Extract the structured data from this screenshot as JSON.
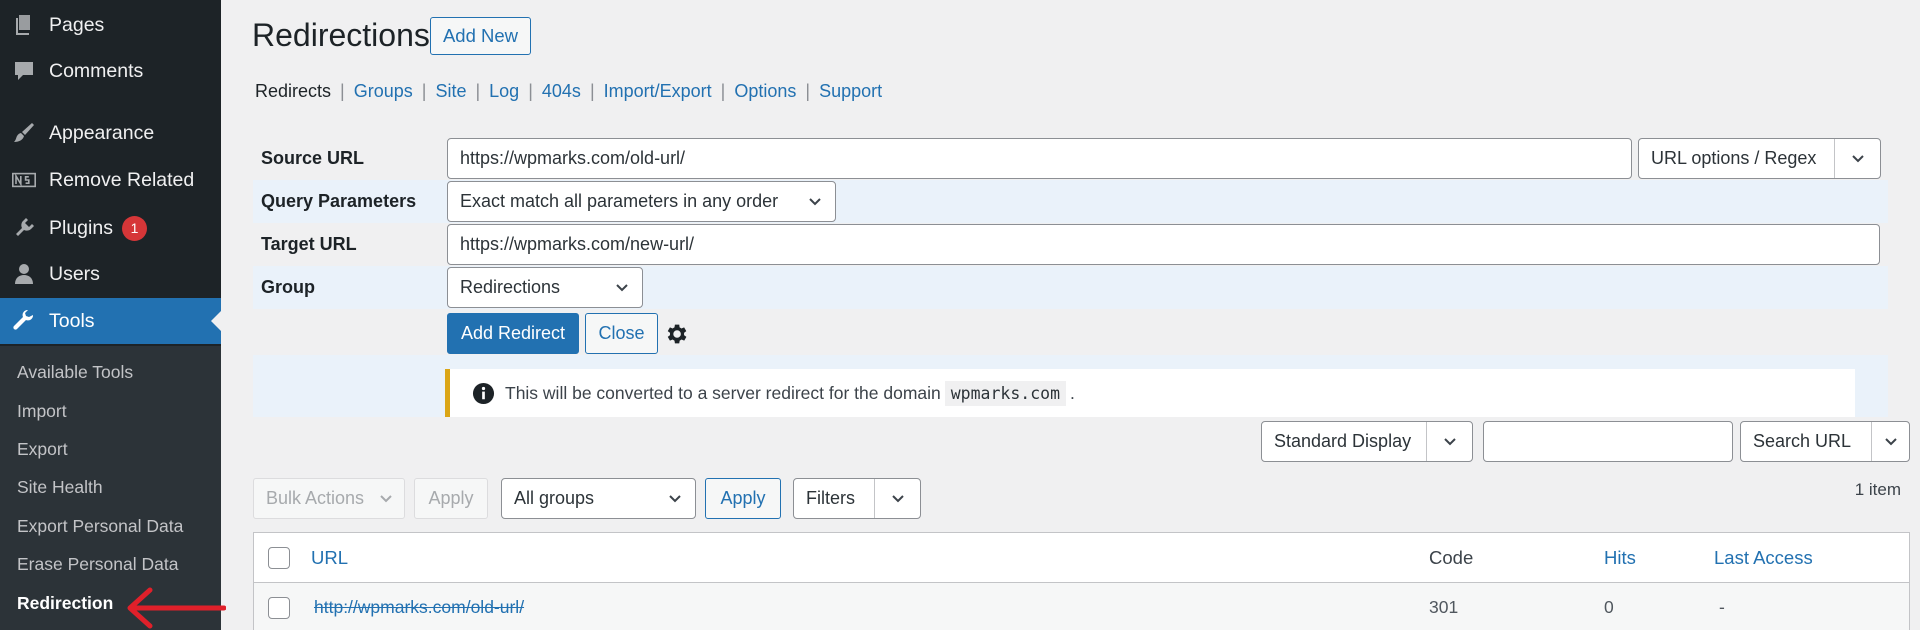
{
  "sidebar": {
    "items": [
      {
        "label": "Pages",
        "icon": "pages-icon"
      },
      {
        "label": "Comments",
        "icon": "comments-icon"
      },
      {
        "label": "Appearance",
        "icon": "appearance-brush-icon"
      },
      {
        "label": "Remove Related",
        "icon": "ns-logo-icon"
      },
      {
        "label": "Plugins",
        "icon": "plugins-icon",
        "badge": "1"
      },
      {
        "label": "Users",
        "icon": "users-icon"
      },
      {
        "label": "Tools",
        "icon": "wrench-icon",
        "active": true
      }
    ],
    "submenu": [
      "Available Tools",
      "Import",
      "Export",
      "Site Health",
      "Export Personal Data",
      "Erase Personal Data",
      "Redirection"
    ],
    "current_submenu": "Redirection"
  },
  "page": {
    "title": "Redirections",
    "add_new": "Add New"
  },
  "subnav": [
    "Redirects",
    "Groups",
    "Site",
    "Log",
    "404s",
    "Import/Export",
    "Options",
    "Support"
  ],
  "form": {
    "source_label": "Source URL",
    "source_value": "https://wpmarks.com/old-url/",
    "url_options": "URL options / Regex",
    "query_label": "Query Parameters",
    "query_value": "Exact match all parameters in any order",
    "target_label": "Target URL",
    "target_value": "https://wpmarks.com/new-url/",
    "group_label": "Group",
    "group_value": "Redirections",
    "add_redirect": "Add Redirect",
    "close": "Close"
  },
  "notice": {
    "text_before": "This will be converted to a server redirect for the domain",
    "domain": "wpmarks.com",
    "text_after": "."
  },
  "filters": {
    "display": "Standard Display",
    "search_value": "",
    "search_button": "Search URL",
    "bulk_actions": "Bulk Actions",
    "apply": "Apply",
    "groups": "All groups",
    "apply2": "Apply",
    "filters": "Filters",
    "item_count": "1 item"
  },
  "table": {
    "columns": [
      "URL",
      "Code",
      "Hits",
      "Last Access"
    ],
    "rows": [
      {
        "url": "http://wpmarks.com/old-url/",
        "code": "301",
        "hits": "0",
        "last_access": "-"
      }
    ]
  },
  "colors": {
    "sidebar_bg": "#1d2327",
    "submenu_bg": "#2c3338",
    "accent": "#2271b1",
    "badge": "#d63638",
    "notice_border": "#dba617",
    "annotation_arrow": "#e0202a"
  }
}
